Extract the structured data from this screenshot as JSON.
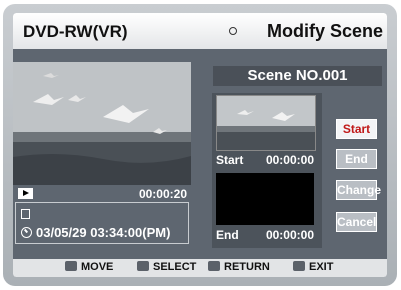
{
  "header": {
    "app_title": "DVD-RW(VR)",
    "menu_title": "Modify Scene",
    "menu_icon": "circle-icon"
  },
  "preview": {
    "time": "00:00:20",
    "play_icon": "play-icon",
    "datetime": "03/05/29 03:34:00(PM)",
    "disc_icon": "disc-icon",
    "clock_icon": "clock-icon"
  },
  "scene": {
    "header": "Scene NO.001",
    "start_label": "Start",
    "start_time": "00:00:00",
    "end_label": "End",
    "end_time": "00:00:00"
  },
  "buttons": {
    "start": "Start",
    "end": "End",
    "change": "Change",
    "cancel": "Cancel"
  },
  "footer": {
    "move": "MOVE",
    "select": "SELECT",
    "return": "RETURN",
    "exit": "EXIT"
  }
}
